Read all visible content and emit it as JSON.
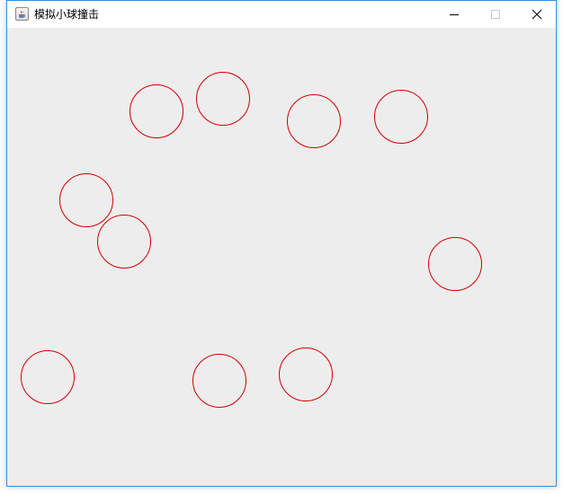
{
  "window": {
    "title": "模拟小球撞击",
    "icon": "java-cup-icon",
    "controls": [
      "minimize-icon",
      "maximize-icon",
      "close-icon"
    ]
  },
  "canvas": {
    "background": "#eeeded",
    "ball_color": "#d00000",
    "ball_count": 10
  }
}
